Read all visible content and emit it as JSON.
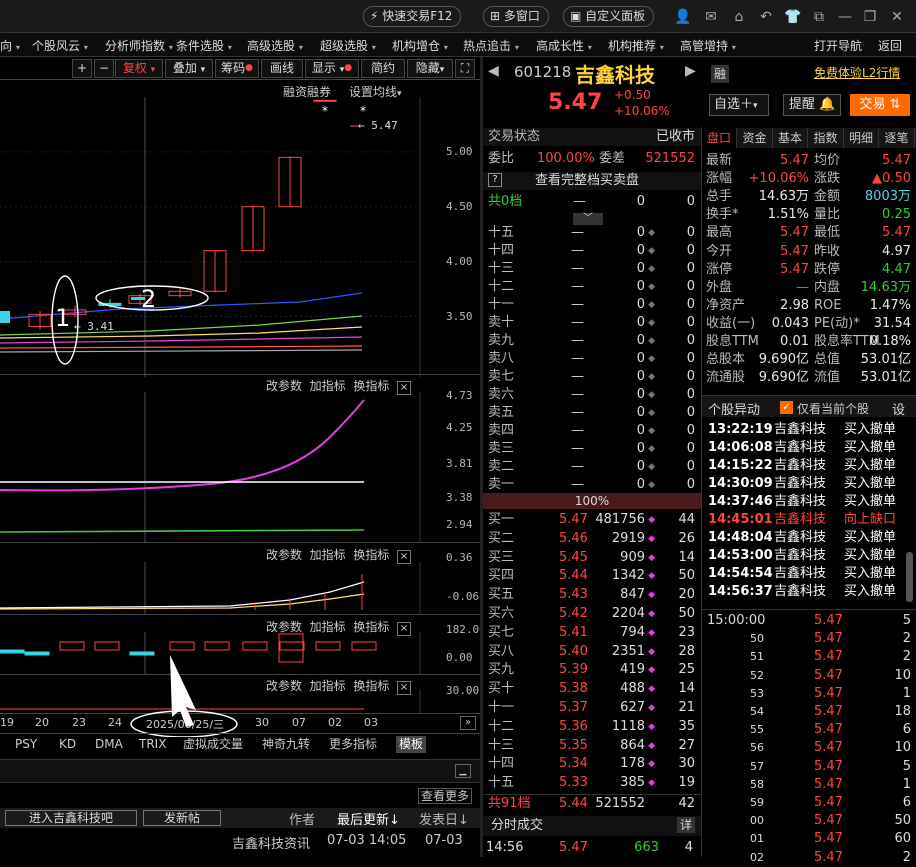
{
  "titlebar": {
    "quick_trade": "快速交易F12",
    "multi_window": "多窗口",
    "custom_panel": "自定义面板"
  },
  "menu": {
    "items": [
      "向",
      "个股风云",
      "分析师指数",
      "条件选股",
      "高级选股",
      "超级选股",
      "机构增仓",
      "热点追击",
      "高成长性",
      "机构推荐",
      "高管增持"
    ],
    "open_nav": "打开导航",
    "back": "返回"
  },
  "chart_toolbar": {
    "plus": "+",
    "minus": "−",
    "restore": "复权",
    "overlay": "叠加",
    "chips": "筹码",
    "draw": "画线",
    "display": "显示",
    "simple": "简约",
    "hide": "隐藏",
    "margin": "融资融券",
    "ma_setting": "设置均线"
  },
  "chart_data": {
    "type": "candlestick",
    "price_ticks": [
      "5.00",
      "4.50",
      "4.00",
      "3.50"
    ],
    "price_ylim": [
      3.0,
      5.5
    ],
    "high_label": "5.47",
    "low_label": "3.41",
    "candles": [
      {
        "o": 3.41,
        "c": 3.52,
        "h": 3.55,
        "l": 3.38
      },
      {
        "o": 3.52,
        "c": 3.56,
        "h": 3.6,
        "l": 3.49
      },
      {
        "o": 3.62,
        "c": 3.6,
        "h": 3.66,
        "l": 3.58
      },
      {
        "o": 3.62,
        "c": 3.69,
        "h": 3.71,
        "l": 3.6
      },
      {
        "o": 3.69,
        "c": 3.73,
        "h": 3.75,
        "l": 3.67
      },
      {
        "o": 3.73,
        "c": 4.1,
        "h": 4.1,
        "l": 3.72
      },
      {
        "o": 4.1,
        "c": 4.5,
        "h": 4.51,
        "l": 4.1
      },
      {
        "o": 4.5,
        "c": 4.95,
        "h": 4.96,
        "l": 4.5
      },
      {
        "o": 5.47,
        "c": 5.47,
        "h": 5.47,
        "l": 5.47
      }
    ],
    "panel2_ticks": [
      "4.73",
      "4.25",
      "3.81",
      "3.38",
      "2.94"
    ],
    "panel3_ticks": [
      "0.36",
      "-0.06"
    ],
    "panel4_ticks": [
      "182.00",
      "0.00"
    ],
    "panel5_ticks": [
      "30.00"
    ],
    "date_labels": [
      "19",
      "20",
      "23",
      "24",
      "2025/06/25/三",
      "30",
      "07",
      "02",
      "03"
    ]
  },
  "chart_annotations": {
    "one": "1",
    "two": "2"
  },
  "panel_controls": {
    "change_params": "改参数",
    "add_indicator": "加指标",
    "swap_indicator": "换指标",
    "close": "×"
  },
  "indicator_tabs": [
    "PSY",
    "KD",
    "DMA",
    "TRIX",
    "虚拟成交量",
    "神奇九转",
    "更多指标",
    "模板"
  ],
  "news": {
    "view_more": "查看更多",
    "forum": "进入吉鑫科技吧",
    "post": "发新帖",
    "author": "作者",
    "last_update": "最后更新↓",
    "post_date": "发表日↓",
    "item_title": "吉鑫科技资讯",
    "item_update": "07-03 14:05",
    "item_date": "07-03"
  },
  "quote": {
    "code": "601218",
    "name": "吉鑫科技",
    "price": "5.47",
    "change": "+0.50",
    "change_pct": "+10.06%",
    "margin_tag": "融",
    "l2_link": "免费体验L2行情",
    "watchlist": "自选",
    "alert": "提醒",
    "trade": "交易"
  },
  "book": {
    "status_label": "交易状态",
    "status_value": "已收市",
    "ratio_label": "委比",
    "ratio_value": "100.00%",
    "diff_label": "委差",
    "diff_value": "521552",
    "help": "?",
    "full_depth": "查看完整档买卖盘",
    "top_total": {
      "label": "共0档",
      "dash": "—",
      "vol": "0",
      "cnt": "0"
    },
    "far_asks": [
      {
        "label": "十五",
        "price": "—",
        "vol": "0",
        "cnt": "0"
      },
      {
        "label": "十四",
        "price": "—",
        "vol": "0",
        "cnt": "0"
      },
      {
        "label": "十三",
        "price": "—",
        "vol": "0",
        "cnt": "0"
      },
      {
        "label": "十二",
        "price": "—",
        "vol": "0",
        "cnt": "0"
      },
      {
        "label": "十一",
        "price": "—",
        "vol": "0",
        "cnt": "0"
      },
      {
        "label": "卖十",
        "price": "—",
        "vol": "0",
        "cnt": "0"
      },
      {
        "label": "卖九",
        "price": "—",
        "vol": "0",
        "cnt": "0"
      },
      {
        "label": "卖八",
        "price": "—",
        "vol": "0",
        "cnt": "0"
      },
      {
        "label": "卖七",
        "price": "—",
        "vol": "0",
        "cnt": "0"
      },
      {
        "label": "卖六",
        "price": "—",
        "vol": "0",
        "cnt": "0"
      },
      {
        "label": "卖五",
        "price": "—",
        "vol": "0",
        "cnt": "0"
      },
      {
        "label": "卖四",
        "price": "—",
        "vol": "0",
        "cnt": "0"
      },
      {
        "label": "卖三",
        "price": "—",
        "vol": "0",
        "cnt": "0"
      },
      {
        "label": "卖二",
        "price": "—",
        "vol": "0",
        "cnt": "0"
      },
      {
        "label": "卖一",
        "price": "—",
        "vol": "0",
        "cnt": "0"
      }
    ],
    "bar_pct": "100%",
    "bids": [
      {
        "label": "买一",
        "price": "5.47",
        "vol": "481756",
        "cnt": "44"
      },
      {
        "label": "买二",
        "price": "5.46",
        "vol": "2919",
        "cnt": "26"
      },
      {
        "label": "买三",
        "price": "5.45",
        "vol": "909",
        "cnt": "14"
      },
      {
        "label": "买四",
        "price": "5.44",
        "vol": "1342",
        "cnt": "50"
      },
      {
        "label": "买五",
        "price": "5.43",
        "vol": "847",
        "cnt": "20"
      },
      {
        "label": "买六",
        "price": "5.42",
        "vol": "2204",
        "cnt": "50"
      },
      {
        "label": "买七",
        "price": "5.41",
        "vol": "794",
        "cnt": "23"
      },
      {
        "label": "买八",
        "price": "5.40",
        "vol": "2351",
        "cnt": "28"
      },
      {
        "label": "买九",
        "price": "5.39",
        "vol": "419",
        "cnt": "25"
      },
      {
        "label": "买十",
        "price": "5.38",
        "vol": "488",
        "cnt": "14"
      },
      {
        "label": "十一",
        "price": "5.37",
        "vol": "627",
        "cnt": "21"
      },
      {
        "label": "十二",
        "price": "5.36",
        "vol": "1118",
        "cnt": "35"
      },
      {
        "label": "十三",
        "price": "5.35",
        "vol": "864",
        "cnt": "27"
      },
      {
        "label": "十四",
        "price": "5.34",
        "vol": "178",
        "cnt": "30"
      },
      {
        "label": "十五",
        "price": "5.33",
        "vol": "385",
        "cnt": "19"
      }
    ],
    "bottom_total": {
      "label": "共91档",
      "price": "5.44",
      "vol": "521552",
      "cnt": "42"
    },
    "time_trades": "分时成交",
    "detail": "详",
    "last_trade": {
      "time": "14:56",
      "price": "5.47",
      "vol": "663",
      "cnt": "4"
    }
  },
  "info": {
    "tabs": [
      "盘口",
      "资金",
      "基本",
      "指数",
      "明细",
      "逐笔"
    ],
    "rows": [
      {
        "l1": "最新",
        "v1": "5.47",
        "c1": "red",
        "l2": "均价",
        "v2": "5.47",
        "c2": "red"
      },
      {
        "l1": "涨幅",
        "v1": "+10.06%",
        "c1": "red",
        "l2": "涨跌",
        "v2": "▲0.50",
        "c2": "red"
      },
      {
        "l1": "总手",
        "v1": "14.63万",
        "c1": "white",
        "l2": "金额",
        "v2": "8003万",
        "c2": "cyan"
      },
      {
        "l1": "换手*",
        "v1": "1.51%",
        "c1": "white",
        "l2": "量比",
        "v2": "0.25",
        "c2": "green"
      },
      {
        "l1": "最高",
        "v1": "5.47",
        "c1": "red",
        "l2": "最低",
        "v2": "5.47",
        "c2": "red"
      },
      {
        "l1": "今开",
        "v1": "5.47",
        "c1": "red",
        "l2": "昨收",
        "v2": "4.97",
        "c2": "white"
      },
      {
        "l1": "涨停",
        "v1": "5.47",
        "c1": "red",
        "l2": "跌停",
        "v2": "4.47",
        "c2": "green"
      },
      {
        "l1": "外盘",
        "v1": "—",
        "c1": "red",
        "l2": "内盘",
        "v2": "14.63万",
        "c2": "green"
      },
      {
        "l1": "净资产",
        "v1": "2.98",
        "c1": "white",
        "l2": "ROE",
        "v2": "1.47%",
        "c2": "white"
      },
      {
        "l1": "收益(一)",
        "v1": "0.043",
        "c1": "white",
        "l2": "PE(动)*",
        "v2": "31.54",
        "c2": "white"
      },
      {
        "l1": "股息TTM",
        "v1": "0.01",
        "c1": "white",
        "l2": "股息率TTM",
        "v2": "0.18%",
        "c2": "white"
      },
      {
        "l1": "总股本",
        "v1": "9.690亿",
        "c1": "white",
        "l2": "总值",
        "v2": "53.01亿",
        "c2": "white"
      },
      {
        "l1": "流通股",
        "v1": "9.690亿",
        "c1": "white",
        "l2": "流值",
        "v2": "53.01亿",
        "c2": "white"
      }
    ],
    "anomaly_title": "个股异动",
    "only_current": "仅看当前个股",
    "settings": "设",
    "signals": [
      {
        "time": "13:22:19",
        "name": "吉鑫科技",
        "type": "买入撤单",
        "hl": false
      },
      {
        "time": "14:06:08",
        "name": "吉鑫科技",
        "type": "买入撤单",
        "hl": false
      },
      {
        "time": "14:15:22",
        "name": "吉鑫科技",
        "type": "买入撤单",
        "hl": false
      },
      {
        "time": "14:30:09",
        "name": "吉鑫科技",
        "type": "买入撤单",
        "hl": false
      },
      {
        "time": "14:37:46",
        "name": "吉鑫科技",
        "type": "买入撤单",
        "hl": false
      },
      {
        "time": "14:45:01",
        "name": "吉鑫科技",
        "type": "向上缺口",
        "hl": true
      },
      {
        "time": "14:48:04",
        "name": "吉鑫科技",
        "type": "买入撤单",
        "hl": false
      },
      {
        "time": "14:53:00",
        "name": "吉鑫科技",
        "type": "买入撤单",
        "hl": false
      },
      {
        "time": "14:54:54",
        "name": "吉鑫科技",
        "type": "买入撤单",
        "hl": false
      },
      {
        "time": "14:56:37",
        "name": "吉鑫科技",
        "type": "买入撤单",
        "hl": false
      }
    ],
    "ticks": [
      {
        "t": "15:00:00",
        "p": "5.47",
        "v": "5"
      },
      {
        "t": "50",
        "p": "5.47",
        "v": "2"
      },
      {
        "t": "51",
        "p": "5.47",
        "v": "2"
      },
      {
        "t": "52",
        "p": "5.47",
        "v": "10"
      },
      {
        "t": "53",
        "p": "5.47",
        "v": "1"
      },
      {
        "t": "54",
        "p": "5.47",
        "v": "18"
      },
      {
        "t": "55",
        "p": "5.47",
        "v": "6"
      },
      {
        "t": "56",
        "p": "5.47",
        "v": "10"
      },
      {
        "t": "57",
        "p": "5.47",
        "v": "5"
      },
      {
        "t": "58",
        "p": "5.47",
        "v": "1"
      },
      {
        "t": "59",
        "p": "5.47",
        "v": "6"
      },
      {
        "t": "00",
        "p": "5.47",
        "v": "50"
      },
      {
        "t": "01",
        "p": "5.47",
        "v": "60"
      },
      {
        "t": "02",
        "p": "5.47",
        "v": "2"
      }
    ]
  },
  "colors": {
    "up": "#ff4545",
    "down": "#2ed12e",
    "accent": "#ff6a00",
    "cyan": "#4fd6e8"
  }
}
